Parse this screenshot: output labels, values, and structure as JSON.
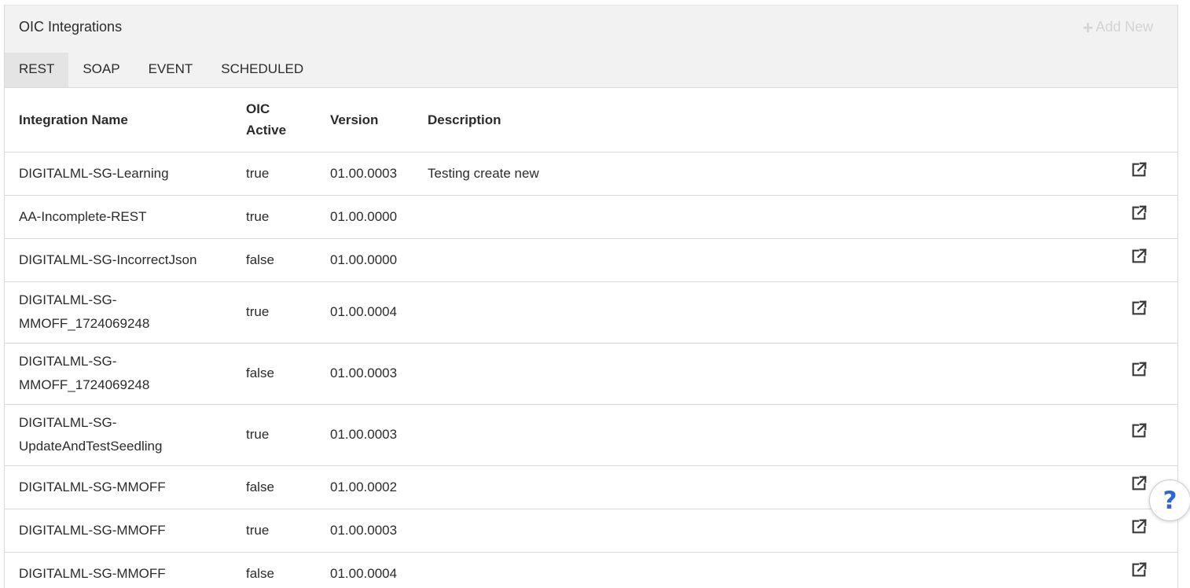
{
  "panel": {
    "title": "OIC Integrations",
    "add_new_label": "Add New"
  },
  "tabs": [
    {
      "label": "REST",
      "active": true
    },
    {
      "label": "SOAP",
      "active": false
    },
    {
      "label": "EVENT",
      "active": false
    },
    {
      "label": "SCHEDULED",
      "active": false
    }
  ],
  "table": {
    "headers": {
      "name": "Integration Name",
      "active_line1": "OIC",
      "active_line2": "Active",
      "version": "Version",
      "description": "Description"
    },
    "rows": [
      {
        "name_line1": "DIGITALML-SG-Learning",
        "name_line2": "",
        "active": "true",
        "version": "01.00.0003",
        "description": "Testing create new"
      },
      {
        "name_line1": "AA-Incomplete-REST",
        "name_line2": "",
        "active": "true",
        "version": "01.00.0000",
        "description": ""
      },
      {
        "name_line1": "DIGITALML-SG-IncorrectJson",
        "name_line2": "",
        "active": "false",
        "version": "01.00.0000",
        "description": ""
      },
      {
        "name_line1": "DIGITALML-SG-",
        "name_line2": "MMOFF_1724069248",
        "active": "true",
        "version": "01.00.0004",
        "description": ""
      },
      {
        "name_line1": "DIGITALML-SG-",
        "name_line2": "MMOFF_1724069248",
        "active": "false",
        "version": "01.00.0003",
        "description": ""
      },
      {
        "name_line1": "DIGITALML-SG-",
        "name_line2": "UpdateAndTestSeedling",
        "active": "true",
        "version": "01.00.0003",
        "description": ""
      },
      {
        "name_line1": "DIGITALML-SG-MMOFF",
        "name_line2": "",
        "active": "false",
        "version": "01.00.0002",
        "description": ""
      },
      {
        "name_line1": "DIGITALML-SG-MMOFF",
        "name_line2": "",
        "active": "true",
        "version": "01.00.0003",
        "description": ""
      },
      {
        "name_line1": "DIGITALML-SG-MMOFF",
        "name_line2": "",
        "active": "false",
        "version": "01.00.0004",
        "description": ""
      }
    ],
    "row_action_icon": "external-link-icon"
  },
  "help": {
    "label": "?",
    "icon": "help-icon",
    "color": "#2f66d6"
  },
  "colors": {
    "header_bg": "#f2f2f2",
    "active_tab_bg": "#e4e4e4",
    "add_new_disabled": "#d3d3d3"
  }
}
